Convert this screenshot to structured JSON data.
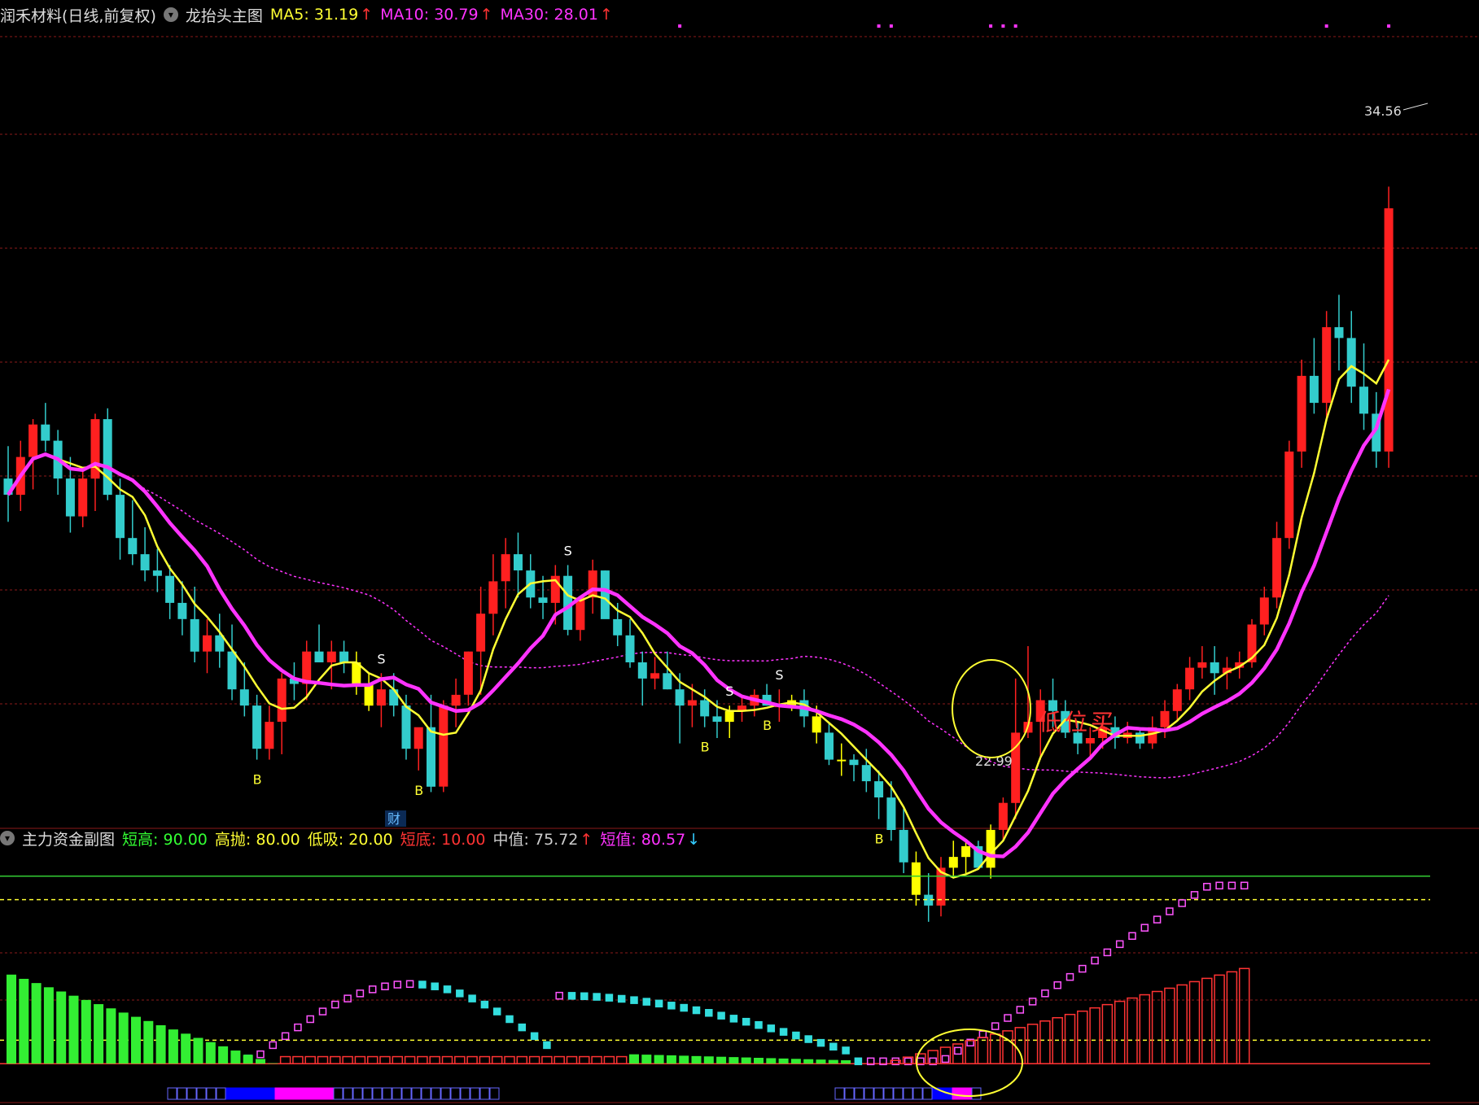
{
  "main_legend": {
    "stock_name": "润禾材料(日线,前复权)",
    "indicator_name": "龙抬头主图",
    "ma": [
      {
        "label": "MA5",
        "value": "31.19",
        "trend": "↑",
        "color": "#ffff33"
      },
      {
        "label": "MA10",
        "value": "30.79",
        "trend": "↑",
        "color": "#ff33ff"
      },
      {
        "label": "MA30",
        "value": "28.01",
        "trend": "↑",
        "color": "#ff33ff"
      }
    ]
  },
  "sub_legend": {
    "indicator_name": "主力资金副图",
    "items": [
      {
        "label": "短高",
        "value": "90.00",
        "trend": "",
        "color": "#33ff33"
      },
      {
        "label": "高抛",
        "value": "80.00",
        "trend": "",
        "color": "#ffff33"
      },
      {
        "label": "低吸",
        "value": "20.00",
        "trend": "",
        "color": "#ffff33"
      },
      {
        "label": "短底",
        "value": "10.00",
        "trend": "",
        "color": "#ff3333"
      },
      {
        "label": "中值",
        "value": "75.72",
        "trend": "↑",
        "color": "#cccccc"
      },
      {
        "label": "短值",
        "value": "80.57",
        "trend": "↓",
        "color": "#ff33ff"
      }
    ]
  },
  "annotations": {
    "high_price": "34.56",
    "low_price": "22.99",
    "buy_text": "低位买",
    "finance_marker": "财",
    "buy_signal": "B",
    "sell_signal": "S"
  },
  "colors": {
    "up": "#ff2020",
    "down": "#33cccc",
    "highlight": "#ffff00",
    "ma5": "#ffff33",
    "ma10": "#ff33ff",
    "ma30": "#ff33ff",
    "grid": "#8b1a1a",
    "circle": "#ffff33",
    "buy_text": "#ff3333"
  },
  "chart_data": [
    {
      "type": "candlestick",
      "title": "",
      "ylim": [
        22,
        36
      ],
      "candles": [
        [
          28.2,
          28.8,
          27.4,
          27.9
        ],
        [
          27.9,
          28.9,
          27.6,
          28.6
        ],
        [
          28.6,
          29.3,
          28.0,
          29.2
        ],
        [
          29.2,
          29.6,
          28.7,
          28.9
        ],
        [
          28.9,
          29.1,
          27.9,
          28.2
        ],
        [
          28.2,
          28.6,
          27.2,
          27.5
        ],
        [
          27.5,
          28.4,
          27.3,
          28.2
        ],
        [
          28.2,
          29.4,
          27.6,
          29.3
        ],
        [
          29.3,
          29.5,
          27.8,
          27.9
        ],
        [
          27.9,
          28.2,
          26.7,
          27.1
        ],
        [
          27.1,
          27.8,
          26.6,
          26.8
        ],
        [
          26.8,
          27.3,
          26.3,
          26.5
        ],
        [
          26.5,
          26.9,
          26.1,
          26.4
        ],
        [
          26.4,
          26.6,
          25.6,
          25.9
        ],
        [
          25.9,
          26.3,
          25.3,
          25.6
        ],
        [
          25.6,
          26.2,
          24.8,
          25.0
        ],
        [
          25.0,
          25.6,
          24.6,
          25.3
        ],
        [
          25.3,
          25.7,
          24.7,
          25.0
        ],
        [
          25.0,
          25.5,
          24.1,
          24.3
        ],
        [
          24.3,
          24.8,
          23.8,
          24.0
        ],
        [
          24.0,
          24.2,
          23.0,
          23.2
        ],
        [
          23.2,
          24.0,
          23.0,
          23.7
        ],
        [
          23.7,
          24.6,
          23.1,
          24.5
        ],
        [
          24.5,
          24.8,
          24.1,
          24.4
        ],
        [
          24.4,
          25.2,
          24.1,
          25.0
        ],
        [
          25.0,
          25.5,
          24.8,
          24.8
        ],
        [
          24.8,
          25.2,
          24.3,
          25.0
        ],
        [
          25.0,
          25.2,
          24.6,
          24.8
        ],
        [
          24.8,
          25.0,
          24.2,
          24.4
        ],
        [
          24.4,
          24.6,
          23.9,
          24.0
        ],
        [
          24.0,
          24.6,
          23.6,
          24.3
        ],
        [
          24.3,
          24.6,
          23.8,
          24.0
        ],
        [
          24.0,
          24.2,
          23.0,
          23.2
        ],
        [
          23.2,
          23.5,
          22.8,
          23.6
        ],
        [
          23.6,
          24.2,
          22.4,
          22.5
        ],
        [
          22.5,
          24.1,
          22.4,
          24.0
        ],
        [
          24.0,
          24.5,
          23.6,
          24.2
        ],
        [
          24.2,
          25.0,
          24.0,
          25.0
        ],
        [
          25.0,
          26.2,
          24.2,
          25.7
        ],
        [
          25.7,
          26.8,
          25.3,
          26.3
        ],
        [
          26.3,
          27.1,
          25.8,
          26.8
        ],
        [
          26.8,
          27.2,
          26.0,
          26.5
        ],
        [
          26.5,
          26.8,
          25.8,
          26.0
        ],
        [
          26.0,
          26.4,
          25.6,
          25.9
        ],
        [
          25.9,
          26.6,
          25.5,
          26.4
        ],
        [
          26.4,
          26.6,
          25.3,
          25.4
        ],
        [
          25.4,
          26.0,
          25.2,
          26.0
        ],
        [
          26.0,
          26.7,
          25.7,
          26.5
        ],
        [
          26.5,
          26.5,
          25.8,
          25.6
        ],
        [
          25.6,
          25.9,
          25.1,
          25.3
        ],
        [
          25.3,
          25.6,
          24.7,
          24.8
        ],
        [
          24.8,
          25.0,
          24.0,
          24.5
        ],
        [
          24.5,
          24.9,
          24.3,
          24.6
        ],
        [
          24.6,
          25.0,
          24.3,
          24.3
        ],
        [
          24.3,
          24.6,
          23.3,
          24.0
        ],
        [
          24.0,
          24.4,
          23.6,
          24.1
        ],
        [
          24.1,
          24.3,
          23.6,
          23.8
        ],
        [
          23.8,
          24.1,
          23.4,
          23.7
        ],
        [
          23.7,
          24.0,
          23.4,
          23.9
        ],
        [
          23.9,
          24.2,
          23.7,
          24.0
        ],
        [
          24.0,
          24.3,
          23.8,
          24.2
        ],
        [
          24.2,
          24.4,
          24.0,
          24.0
        ],
        [
          24.0,
          24.3,
          23.7,
          24.0
        ],
        [
          24.0,
          24.2,
          23.9,
          24.1
        ],
        [
          24.1,
          24.3,
          23.6,
          23.8
        ],
        [
          23.8,
          24.0,
          23.3,
          23.5
        ],
        [
          23.5,
          23.7,
          22.9,
          23.0
        ],
        [
          23.0,
          23.3,
          22.7,
          23.0
        ],
        [
          23.0,
          23.1,
          22.6,
          22.9
        ],
        [
          22.9,
          23.2,
          22.4,
          22.6
        ],
        [
          22.6,
          22.8,
          21.9,
          22.3
        ],
        [
          22.3,
          22.6,
          21.5,
          21.7
        ],
        [
          21.7,
          22.1,
          20.9,
          21.1
        ],
        [
          21.1,
          21.3,
          20.3,
          20.5
        ],
        [
          20.5,
          20.9,
          20.0,
          20.3
        ],
        [
          20.3,
          21.2,
          20.1,
          21.0
        ],
        [
          21.0,
          21.5,
          20.8,
          21.2
        ],
        [
          21.2,
          21.5,
          20.9,
          21.4
        ],
        [
          21.4,
          21.5,
          21.0,
          21.0
        ],
        [
          21.0,
          21.8,
          20.8,
          21.7
        ],
        [
          21.7,
          22.3,
          21.5,
          22.2
        ],
        [
          22.2,
          24.5,
          21.9,
          23.5
        ],
        [
          23.5,
          25.1,
          23.4,
          23.7
        ],
        [
          23.7,
          24.3,
          23.0,
          24.1
        ],
        [
          24.1,
          24.5,
          23.6,
          23.9
        ],
        [
          23.9,
          24.1,
          23.4,
          23.5
        ],
        [
          23.5,
          23.7,
          23.1,
          23.3
        ],
        [
          23.3,
          23.6,
          23.0,
          23.4
        ],
        [
          23.4,
          23.8,
          23.2,
          23.6
        ],
        [
          23.6,
          23.8,
          23.2,
          23.4
        ],
        [
          23.4,
          23.7,
          23.3,
          23.5
        ],
        [
          23.5,
          23.6,
          23.2,
          23.3
        ],
        [
          23.3,
          23.8,
          23.2,
          23.6
        ],
        [
          23.6,
          24.1,
          23.4,
          23.9
        ],
        [
          23.9,
          24.4,
          23.7,
          24.3
        ],
        [
          24.3,
          24.9,
          24.1,
          24.7
        ],
        [
          24.7,
          25.1,
          24.5,
          24.8
        ],
        [
          24.8,
          25.1,
          24.2,
          24.6
        ],
        [
          24.6,
          24.9,
          24.3,
          24.7
        ],
        [
          24.7,
          25.0,
          24.5,
          24.8
        ],
        [
          24.8,
          25.6,
          24.7,
          25.5
        ],
        [
          25.5,
          26.2,
          25.3,
          26.0
        ],
        [
          26.0,
          27.4,
          25.8,
          27.1
        ],
        [
          27.1,
          28.9,
          26.9,
          28.7
        ],
        [
          28.7,
          30.4,
          28.4,
          30.1
        ],
        [
          30.1,
          30.8,
          29.4,
          29.6
        ],
        [
          29.6,
          31.3,
          29.3,
          31.0
        ],
        [
          31.0,
          31.6,
          30.2,
          30.8
        ],
        [
          30.8,
          31.3,
          29.6,
          29.9
        ],
        [
          29.9,
          30.7,
          29.1,
          29.4
        ],
        [
          29.4,
          29.8,
          28.4,
          28.7
        ],
        [
          28.7,
          33.6,
          28.4,
          33.2
        ]
      ]
    },
    {
      "type": "line",
      "series": [
        {
          "name": "短高",
          "values": [
            90
          ]
        },
        {
          "name": "高抛",
          "values": [
            80
          ]
        },
        {
          "name": "低吸",
          "values": [
            20
          ]
        },
        {
          "name": "短底",
          "values": [
            10
          ]
        },
        {
          "name": "中值",
          "values": [
            75.72
          ]
        },
        {
          "name": "短值",
          "values": [
            80.57
          ]
        }
      ],
      "ylim": [
        0,
        100
      ]
    }
  ]
}
